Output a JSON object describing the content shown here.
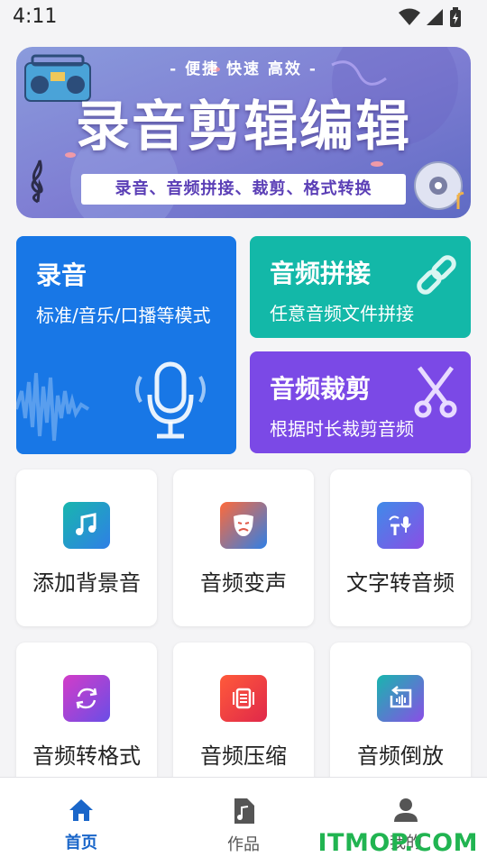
{
  "status": {
    "time": "4:11"
  },
  "banner": {
    "slogan": "- 便捷 快速 高效 -",
    "title": "录音剪辑编辑",
    "tags": "录音、音频拼接、裁剪、格式转换"
  },
  "cards": {
    "record": {
      "title": "录音",
      "subtitle": "标准/音乐/口播等模式"
    },
    "join": {
      "title": "音频拼接",
      "subtitle": "任意音频文件拼接"
    },
    "cut": {
      "title": "音频裁剪",
      "subtitle": "根据时长裁剪音频"
    }
  },
  "tools": [
    {
      "label": "添加背景音",
      "icon": "music-note-icon"
    },
    {
      "label": "音频变声",
      "icon": "mask-icon"
    },
    {
      "label": "文字转音频",
      "icon": "text-to-speech-icon"
    },
    {
      "label": "音频转格式",
      "icon": "convert-icon"
    },
    {
      "label": "音频压缩",
      "icon": "compress-icon"
    },
    {
      "label": "音频倒放",
      "icon": "reverse-icon"
    }
  ],
  "nav": [
    {
      "label": "首页",
      "icon": "home-icon",
      "active": true
    },
    {
      "label": "作品",
      "icon": "music-file-icon",
      "active": false
    },
    {
      "label": "我的",
      "icon": "user-icon",
      "active": false
    }
  ],
  "watermark": "ITMOP.COM",
  "colors": {
    "primary": "#1877e6",
    "teal": "#13b8a8",
    "purple": "#7b49e6",
    "nav_active": "#1a66c9",
    "nav_inactive": "#555555"
  }
}
